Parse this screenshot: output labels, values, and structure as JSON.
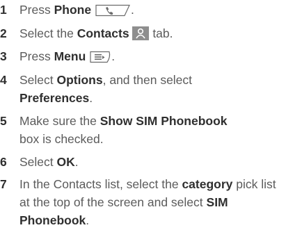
{
  "steps": [
    {
      "number": "1",
      "pre": "Press ",
      "bold": "Phone",
      "icon": "phone-button-icon",
      "post": "."
    },
    {
      "number": "2",
      "pre": "Select the ",
      "bold": "Contacts",
      "icon": "contacts-tab-icon",
      "post": " tab."
    },
    {
      "number": "3",
      "pre": "Press ",
      "bold": "Menu",
      "icon": "menu-button-icon",
      "post": "."
    },
    {
      "number": "4",
      "pre": "Select ",
      "bold": "Options",
      "mid": ", and then select ",
      "bold2": "Preferences",
      "post": "."
    },
    {
      "number": "5",
      "pre": "Make sure the ",
      "bold": "Show SIM Phonebook",
      "post": " box is checked."
    },
    {
      "number": "6",
      "pre": "Select ",
      "bold": "OK",
      "post": "."
    },
    {
      "number": "7",
      "pre": "In the Contacts list, select the ",
      "bold": "category",
      "mid": " pick list at the top of the screen and select ",
      "bold2": "SIM Phonebook",
      "post": "."
    }
  ],
  "colors": {
    "number": "#2f2f2f",
    "text": "#5b5b5b",
    "icon_fill": "#8e8e8e",
    "icon_stroke": "#6a6a6a"
  }
}
